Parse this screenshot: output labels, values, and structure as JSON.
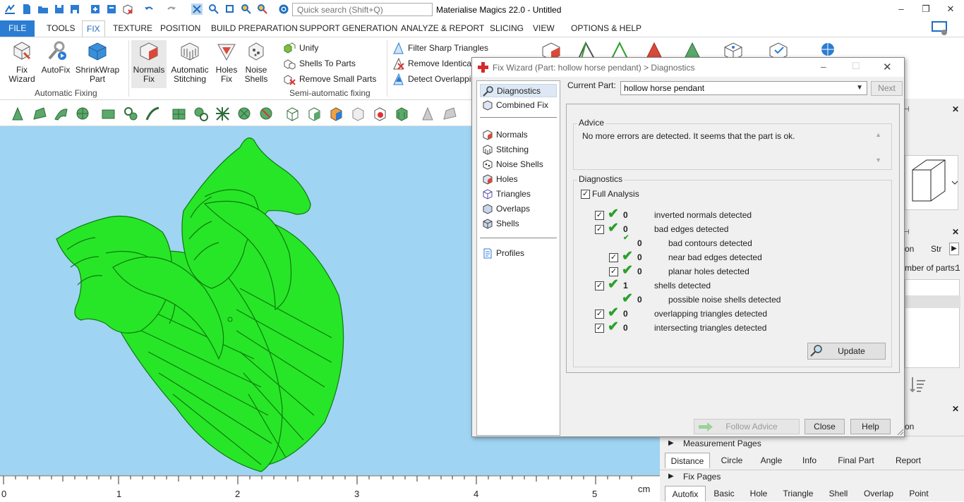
{
  "app": {
    "title": "Materialise Magics 22.0 - Untitled",
    "search_placeholder": "Quick search (Shift+Q)",
    "window_controls": [
      "–",
      "❐",
      "✕"
    ]
  },
  "menu": {
    "file": "FILE",
    "tabs": [
      "TOOLS",
      "FIX",
      "TEXTURE",
      "POSITION",
      "BUILD PREPARATION",
      "SUPPORT GENERATION",
      "ANALYZE & REPORT",
      "SLICING",
      "VIEW",
      "OPTIONS & HELP"
    ],
    "active_tab": "FIX"
  },
  "ribbon": {
    "large_buttons": [
      {
        "label": "Fix\nWizard",
        "icon": "fix-wizard-icon"
      },
      {
        "label": "AutoFix",
        "icon": "autofix-icon"
      },
      {
        "label": "ShrinkWrap\nPart",
        "icon": "shrinkwrap-icon"
      },
      {
        "label": "Normals\nFix",
        "icon": "normals-fix-icon"
      },
      {
        "label": "Automatic\nStitching",
        "icon": "stitching-icon"
      },
      {
        "label": "Holes\nFix",
        "icon": "holes-fix-icon"
      },
      {
        "label": "Noise\nShells",
        "icon": "noise-shells-icon"
      }
    ],
    "small_buttons_col1": [
      "Unify",
      "Shells To Parts",
      "Remove Small Parts"
    ],
    "small_buttons_col2": [
      "Filter Sharp Triangles",
      "Remove Identical",
      "Detect Overlappi"
    ],
    "groups": [
      "Automatic Fixing",
      "Semi-automatic fixing"
    ]
  },
  "ruler": {
    "labels": [
      "0",
      "1",
      "2",
      "3",
      "4",
      "5"
    ],
    "unit": "cm"
  },
  "right_panel": {
    "tab_fragments": [
      "on",
      "Str",
      "mber of parts:",
      "1",
      "on"
    ],
    "measurement_pages": {
      "title": "Measurement Pages",
      "tabs": [
        "Distance",
        "Circle",
        "Angle",
        "Info",
        "Final Part",
        "Report"
      ],
      "active": "Distance"
    },
    "fix_pages": {
      "title": "Fix Pages",
      "tabs": [
        "Autofix",
        "Basic",
        "Hole",
        "Triangle",
        "Shell",
        "Overlap",
        "Point"
      ],
      "active": "Autofix"
    }
  },
  "dialog": {
    "title": "Fix Wizard (Part: hollow horse pendant) > Diagnostics",
    "nav": {
      "group1": [
        "Diagnostics",
        "Combined Fix"
      ],
      "group2": [
        "Normals",
        "Stitching",
        "Noise Shells",
        "Holes",
        "Triangles",
        "Overlaps",
        "Shells"
      ],
      "group3": [
        "Profiles"
      ],
      "selected": "Diagnostics"
    },
    "current_part_label": "Current Part:",
    "current_part_value": "hollow horse pendant",
    "next_button": "Next",
    "advice": {
      "title": "Advice",
      "text": "No more errors are detected. It seems that the part is ok."
    },
    "diagnostics": {
      "title": "Diagnostics",
      "full_analysis_label": "Full Analysis",
      "full_analysis_checked": true,
      "rows": [
        {
          "checkbox": true,
          "checked": true,
          "count": "0",
          "label": "inverted normals detected",
          "indent": 0
        },
        {
          "checkbox": true,
          "checked": true,
          "count": "0",
          "label": "bad edges detected",
          "indent": 0
        },
        {
          "checkbox": false,
          "checked": false,
          "count": "0",
          "label": "bad contours detected",
          "indent": 1
        },
        {
          "checkbox": true,
          "checked": true,
          "count": "0",
          "label": "near bad edges detected",
          "indent": 1
        },
        {
          "checkbox": true,
          "checked": true,
          "count": "0",
          "label": "planar holes detected",
          "indent": 1
        },
        {
          "checkbox": true,
          "checked": true,
          "count": "1",
          "label": "shells detected",
          "indent": 0
        },
        {
          "checkbox": false,
          "checked": false,
          "count": "0",
          "label": "possible noise shells detected",
          "indent": 1
        },
        {
          "checkbox": true,
          "checked": true,
          "count": "0",
          "label": "overlapping triangles detected",
          "indent": 0
        },
        {
          "checkbox": true,
          "checked": true,
          "count": "0",
          "label": "intersecting triangles detected",
          "indent": 0
        }
      ]
    },
    "update_button": "Update",
    "follow_advice_button": "Follow Advice",
    "close_button": "Close",
    "help_button": "Help"
  },
  "colors": {
    "viewport_bg": "#9fd4f2",
    "model_green": "#27e627",
    "accent_blue": "#2b7cd3",
    "check_green": "#2aa12a"
  }
}
